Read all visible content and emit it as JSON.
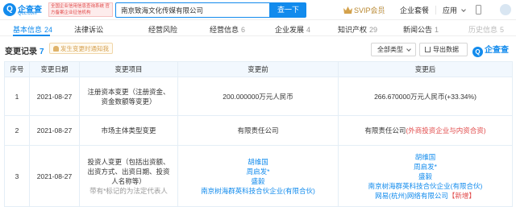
{
  "topbar": {
    "logo_badge": "Q",
    "logo_name": "企查查",
    "logo_domain": "Qcc.com",
    "reg_note": "全国企业信用信息查询系统 官方备案企业征信机构",
    "search_value": "南京致海文化传媒有限公司",
    "search_button": "查一下",
    "svip_label": "SVIP会员",
    "enterprise_label": "企业套餐",
    "apps_label": "应用"
  },
  "tabs": [
    {
      "label": "基本信息",
      "count": "24"
    },
    {
      "label": "法律诉讼",
      "count": ""
    },
    {
      "label": "经营风险",
      "count": ""
    },
    {
      "label": "经营信息",
      "count": "6"
    },
    {
      "label": "企业发展",
      "count": "4"
    },
    {
      "label": "知识产权",
      "count": "29"
    },
    {
      "label": "新闻公告",
      "count": "1"
    },
    {
      "label": "历史信息",
      "count": "5"
    }
  ],
  "section": {
    "title": "变更记录",
    "count": "7",
    "notify_label": "发生变更时通知我",
    "type_select": "全部类型",
    "export_label": "导出数据",
    "watermark": "企查查",
    "watermark_badge": "Q"
  },
  "table": {
    "headers": [
      "序号",
      "变更日期",
      "变更项目",
      "变更前",
      "变更后"
    ],
    "rows": [
      {
        "index": "1",
        "date": "2021-08-27",
        "item": "注册资本变更（注册资金、资金数额等变更）",
        "before": "200.000000万元人民币",
        "after": "266.670000万元人民币(+33.34%)"
      },
      {
        "index": "2",
        "date": "2021-08-27",
        "item": "市场主体类型变更",
        "before": "有限责任公司",
        "after_prefix": "有限责任公司",
        "after_highlight": "(外商投资企业与内资合资)"
      },
      {
        "index": "3",
        "date": "2021-08-27",
        "item": "投资人变更（包括出资额、出资方式、出资日期、投资人名称等）",
        "item_note": "带有*标记的为法定代表人",
        "before_list": [
          "胡维国",
          "周启发*",
          "盛毅",
          "南京树海群英科技合伙企业(有限合伙)"
        ],
        "after_list": [
          "胡维国",
          "周启发*",
          "盛毅",
          "南京树海群英科技合伙企业(有限合伙)"
        ],
        "after_last": "网易(杭州)网络有限公司",
        "after_last_tag": "【新增】"
      }
    ]
  },
  "colors": {
    "brand": "#128bed",
    "change_highlight": "#e14a4a",
    "svip_gold": "#b7872f"
  }
}
